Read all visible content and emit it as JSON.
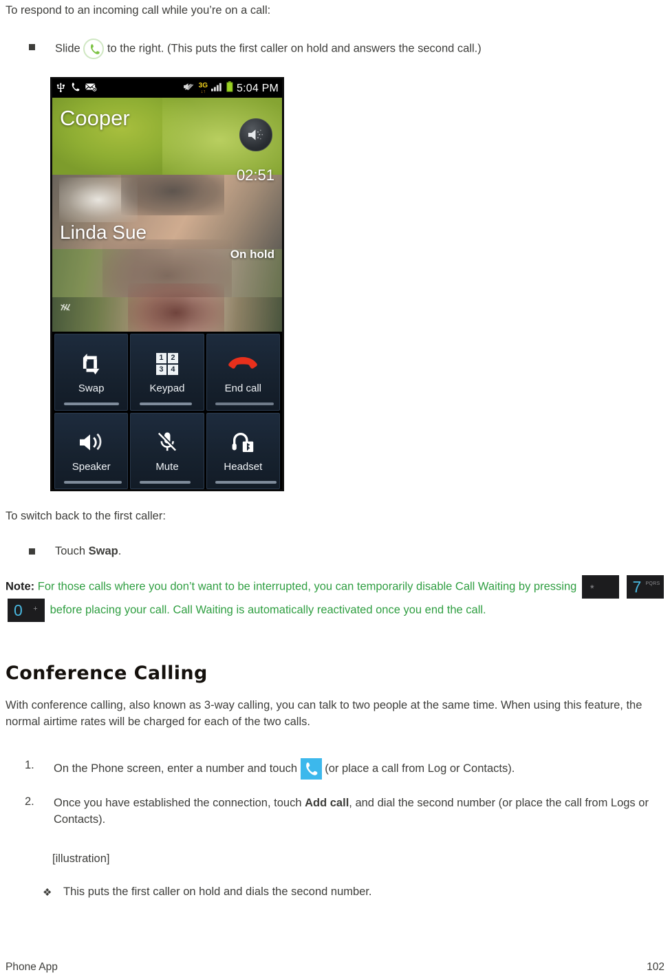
{
  "document": {
    "intro_paragraph": "To respond to an incoming call while you’re on a call:",
    "bullet_1": {
      "text_before_icon": "Slide",
      "icon": "green-call-handset-icon",
      "text_after_icon": "to the right. (This puts the first caller on hold and answers the second call.)"
    },
    "switch_back_paragraph": "To switch back to the first caller:",
    "bullet_2": {
      "text_before": "Touch",
      "bold_word": "Swap",
      "text_after": "."
    },
    "note": {
      "label": "Note:",
      "part_1": "For those calls where you don’t want to be interrupted, you can temporarily disable Call Waiting by pressing",
      "keys": [
        {
          "main": "*",
          "sub": ""
        },
        {
          "main": "7",
          "sub": "PQRS"
        },
        {
          "main": "0",
          "sub": "+"
        }
      ],
      "part_2": "before placing your call. Call Waiting is automatically reactivated once you end the call."
    },
    "heading": "Conference Calling",
    "body_paragraph": "With conference calling, also known as 3-way calling, you can talk to two people at the same time. When using this feature, the normal airtime rates will be charged for each of the two calls.",
    "steps": [
      {
        "number": "1.",
        "text_before_icon": "On the Phone screen, enter a number and touch",
        "icon": "cyan-call-button-icon",
        "text_after_icon": "(or place a call from Log or Contacts)."
      },
      {
        "number": "2.",
        "text_before_bold": "Once you have established the connection, touch",
        "bold_word": "Add call",
        "text_after_bold": ", and dial the second number (or place the call from Logs or Contacts)."
      }
    ],
    "illustration_placeholder": "[illustration]",
    "result_bullet": {
      "marker": "❖",
      "text": "This puts the first caller on hold and dials the second number."
    },
    "footer": {
      "left": "Phone App",
      "right": "102"
    }
  },
  "phone_screenshot": {
    "statusbar": {
      "icons_left": [
        "usb-icon",
        "phone-call-icon",
        "message-icon"
      ],
      "icons_right": [
        "vibrate-off-icon",
        "network-3g-icon",
        "signal-bars-icon",
        "battery-icon"
      ],
      "network_label": "3G",
      "time": "5:04 PM"
    },
    "call_screen": {
      "caller_one_name": "Cooper",
      "call_timer": "02:51",
      "caller_two_name": "Linda Sue",
      "caller_two_status": "On hold",
      "speaker_chip_icon": "speaker-icon",
      "mute_mark_icon": "muted-sound-icon"
    },
    "buttons": [
      {
        "label": "Swap",
        "icon": "swap-arrows-icon"
      },
      {
        "label": "Keypad",
        "icon": "keypad-grid-icon",
        "keys": [
          "1",
          "2",
          "3",
          "4"
        ]
      },
      {
        "label": "End call",
        "icon": "end-call-handset-icon"
      },
      {
        "label": "Speaker",
        "icon": "speaker-waves-icon"
      },
      {
        "label": "Mute",
        "icon": "microphone-muted-icon"
      },
      {
        "label": "Headset",
        "icon": "bluetooth-headset-icon"
      }
    ]
  },
  "colors": {
    "note_green": "#2f9e41",
    "body_text": "#3d3d3a",
    "cyan_button": "#3cb8ec",
    "end_call_red": "#e8301c",
    "button_panel": "#1d2b3d"
  }
}
